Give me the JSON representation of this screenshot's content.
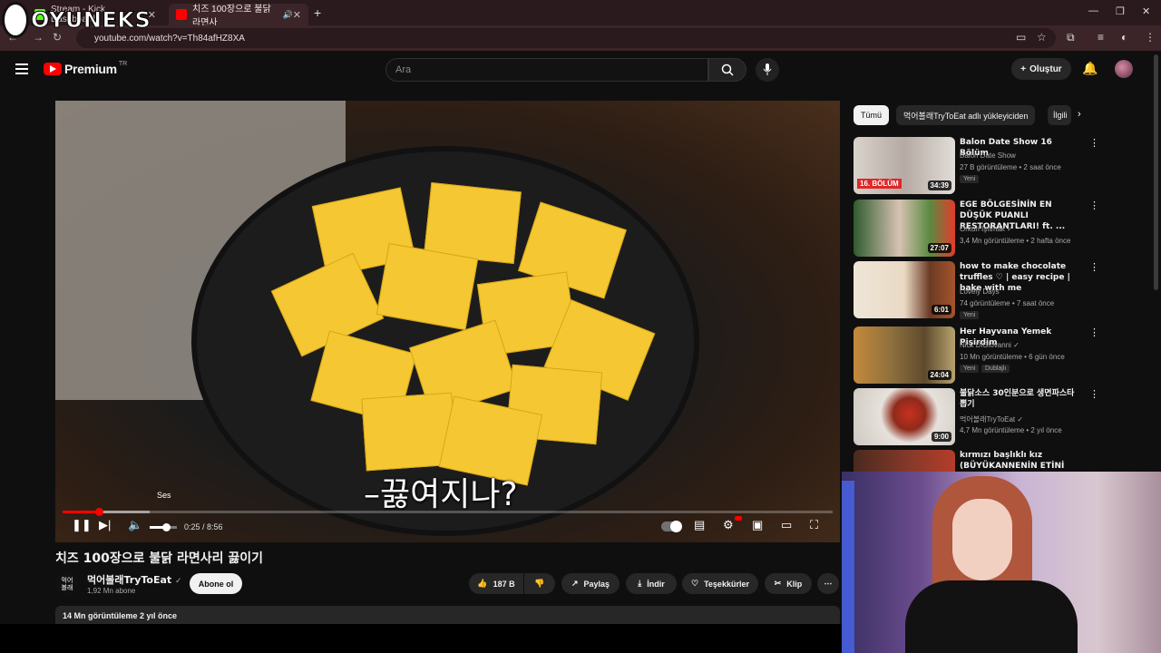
{
  "browser": {
    "tabs": [
      {
        "title": "Stream - Kick Dashboard",
        "favicon_color": "#53fc18",
        "active": false
      },
      {
        "title": "치즈 100장으로 불닭 라면사",
        "favicon_color": "#ff0000",
        "active": true
      }
    ],
    "url": "youtube.com/watch?v=Th84afHZ8XA"
  },
  "overlay_logo": {
    "text": "OYUNEKS"
  },
  "youtube": {
    "logo_text": "Premium",
    "region": "TR",
    "search_placeholder": "Ara",
    "create_label": "Oluştur",
    "player": {
      "subtitle": "–끓여지나?",
      "tooltip": "Ses",
      "time": "0:25 / 8:56",
      "progress_fraction": 0.047,
      "buffer_fraction": 0.113,
      "volume_fraction": 0.6
    },
    "video": {
      "title": "치즈 100장으로 불닭 라면사리 끓이기",
      "channel_avatar": "먹어\n볼래",
      "channel_name": "먹어볼래TryToEat",
      "subscribers": "1,92 Mn abone",
      "subscribe_label": "Abone ol",
      "likes": "187 B",
      "share_label": "Paylaş",
      "download_label": "İndir",
      "thanks_label": "Teşekkürler",
      "clip_label": "Klip",
      "views_date": "14 Mn görüntüleme  2 yıl önce"
    },
    "chips": [
      "Tümü",
      "먹어볼래TryToEat adlı yükleyiciden",
      "İlgili"
    ],
    "recommendations": [
      {
        "title": "Balon Date Show 16 Bölüm",
        "channel": "Balon Date Show",
        "meta": "27 B görüntüleme • 2 saat önce",
        "badge": "Yeni",
        "duration": "34:39",
        "thumb_color": "#c9c2bd"
      },
      {
        "title": "EGE BÖLGESİNİN EN DÜŞÜK PUANLI RESTORANTLARI! ft. ...",
        "channel": "Orkun Işıtmak ✓",
        "meta": "3,4 Mn görüntüleme • 2 hafta önce",
        "badge": "",
        "duration": "27:07",
        "thumb_color": "#3d6b36"
      },
      {
        "title": "how to make chocolate truffles ♡ | easy recipe | bake with me",
        "channel": "Lovely Days",
        "meta": "74 görüntüleme • 7 saat önce",
        "badge": "Yeni",
        "duration": "6:01",
        "thumb_color": "#e6d7c3"
      },
      {
        "title": "Her Hayvana Yemek Pişirdim",
        "channel": "Nick DiGiovanni ✓",
        "meta": "10 Mn görüntüleme • 6 gün önce",
        "badge": "Yeni",
        "badge2": "Dublajlı",
        "duration": "24:04",
        "thumb_color": "#8a6d3d"
      },
      {
        "title": "불닭소스 30인분으로 생면파스타 뽑기",
        "channel": "먹어볼래TryToEat ✓",
        "meta": "4,7 Mn görüntüleme • 2 yıl önce",
        "badge": "",
        "duration": "9:00",
        "thumb_color": "#d8d2cc"
      },
      {
        "title": "kırmızı başlıklı kız (BÜYÜKANNENİN ETİNİ YEME...",
        "channel": "",
        "meta": "",
        "badge": "",
        "duration": "",
        "thumb_color": "#6b3b2a"
      }
    ]
  }
}
